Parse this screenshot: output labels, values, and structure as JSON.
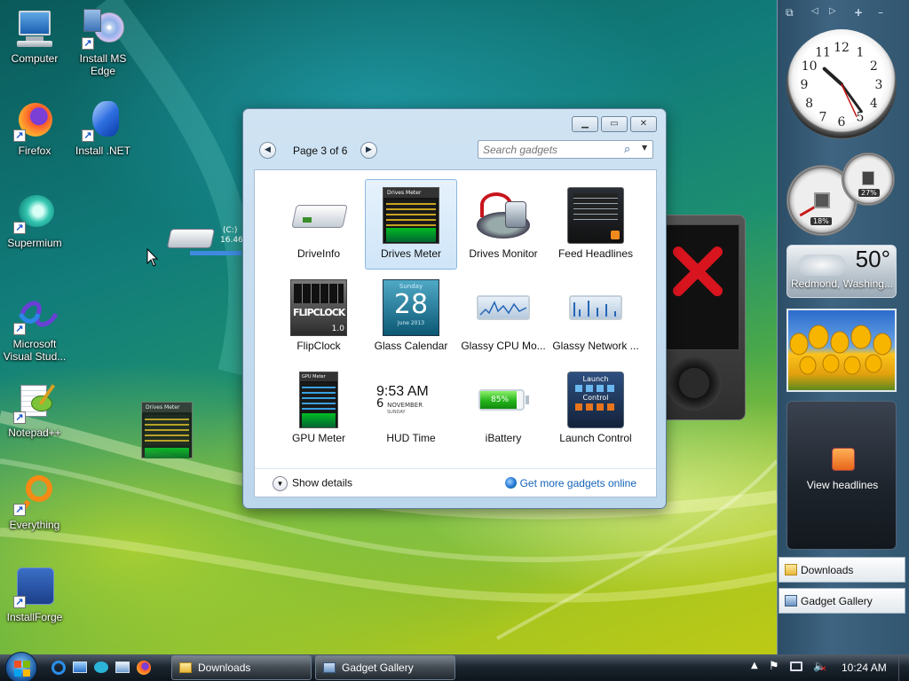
{
  "desktop": {
    "icons": [
      {
        "label": "Computer"
      },
      {
        "label": "Install MS Edge"
      },
      {
        "label": "Firefox"
      },
      {
        "label": "Install .NET"
      },
      {
        "label": "Supermium"
      },
      {
        "label": "Microsoft Visual Stud..."
      },
      {
        "label": "Notepad++"
      },
      {
        "label": "Everything"
      },
      {
        "label": "InstallForge"
      }
    ],
    "drag_drive_label": "(C:)",
    "drag_drive_value": "16.46",
    "drag_thumb_title": "Drives Meter"
  },
  "gallery": {
    "page_label": "Page 3 of 6",
    "search": {
      "placeholder": "Search gadgets"
    },
    "gadgets": [
      {
        "label": "DriveInfo",
        "selected": false
      },
      {
        "label": "Drives Meter",
        "selected": true
      },
      {
        "label": "Drives Monitor",
        "selected": false
      },
      {
        "label": "Feed Headlines",
        "selected": false
      },
      {
        "label": "FlipClock",
        "selected": false
      },
      {
        "label": "Glass Calendar",
        "selected": false
      },
      {
        "label": "Glassy CPU Mo...",
        "selected": false
      },
      {
        "label": "Glassy Network ...",
        "selected": false
      },
      {
        "label": "GPU Meter",
        "selected": false
      },
      {
        "label": "HUD Time",
        "selected": false
      },
      {
        "label": "iBattery",
        "selected": false
      },
      {
        "label": "Launch Control",
        "selected": false
      }
    ],
    "thumbs": {
      "drives_meter_title": "Drives Meter",
      "flipclock_text": "FLIPCLOCK",
      "flipclock_version": "1.0",
      "calendar_month": "Sunday",
      "calendar_day": "28",
      "calendar_footer": "June 2013",
      "gpu_title": "GPU Meter",
      "hud_time": "9:53 AM",
      "hud_day": "6",
      "hud_month": "NOVEMBER",
      "hud_weekday": "SUNDAY",
      "battery_pct": "85%",
      "launch_title": "Launch",
      "launch_sub": "Control"
    },
    "show_details": "Show details",
    "get_more": "Get more gadgets online"
  },
  "sidebar": {
    "clock": {
      "numerals": [
        "12",
        "1",
        "2",
        "3",
        "4",
        "5",
        "6",
        "7",
        "8",
        "9",
        "10",
        "11"
      ],
      "hours": 10,
      "minutes": 24
    },
    "meters": {
      "cpu": "18%",
      "mem": "27%"
    },
    "weather": {
      "temp": "50°",
      "location": "Redmond, Washing..."
    },
    "feed": {
      "label": "View headlines"
    },
    "tasks": [
      {
        "label": "Downloads"
      },
      {
        "label": "Gadget Gallery"
      }
    ]
  },
  "taskbar": {
    "buttons": [
      {
        "label": "Downloads"
      },
      {
        "label": "Gadget Gallery"
      }
    ],
    "time": "10:24 AM"
  }
}
